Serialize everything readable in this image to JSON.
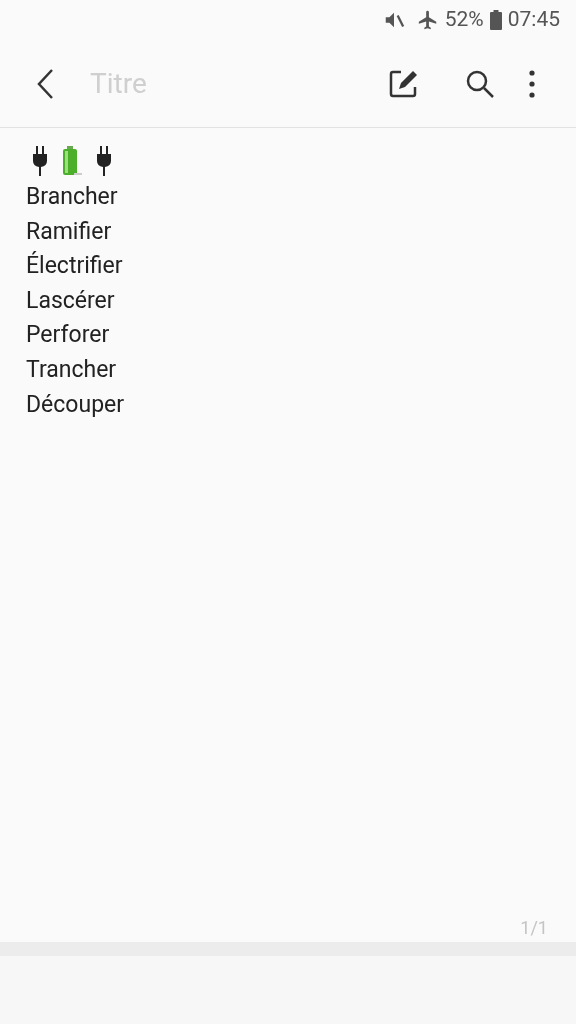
{
  "status_bar": {
    "battery_percent": "52%",
    "time": "07:45"
  },
  "toolbar": {
    "title": {
      "placeholder": "Titre"
    }
  },
  "note": {
    "lines": [
      "Brancher",
      "Ramifier",
      "Électrifier",
      "Lascérer",
      "Perforer",
      "Trancher",
      "Découper"
    ]
  },
  "page_indicator": "1/1"
}
